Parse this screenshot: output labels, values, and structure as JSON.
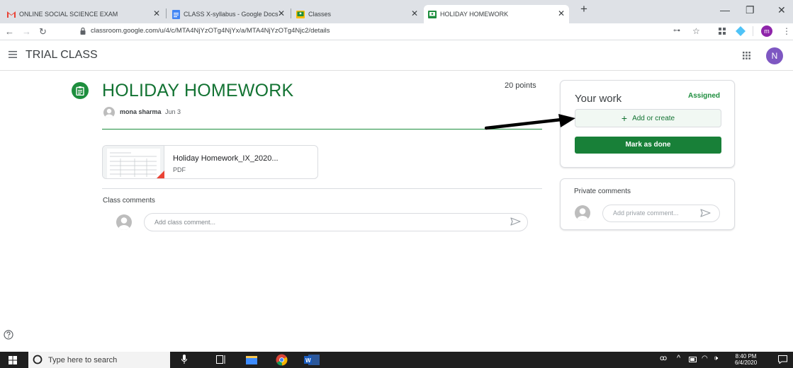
{
  "browser": {
    "tabs": [
      {
        "title": "ONLINE SOCIAL SCIENCE EXAM",
        "icon": "gmail-icon"
      },
      {
        "title": "CLASS X-syllabus - Google Docs",
        "icon": "docs-icon"
      },
      {
        "title": "Classes",
        "icon": "classroom-icon"
      },
      {
        "title": "HOLIDAY HOMEWORK",
        "icon": "classroom-icon",
        "active": true
      }
    ],
    "url": "classroom.google.com/u/4/c/MTA4NjYzOTg4NjYx/a/MTA4NjYzOTg4Njc2/details",
    "profile_initial": "m"
  },
  "app": {
    "class_name": "TRIAL CLASS",
    "account_initial": "N"
  },
  "assignment": {
    "title": "HOLIDAY HOMEWORK",
    "points": "20 points",
    "author": "mona sharma",
    "date": "Jun 3",
    "attachment": {
      "name": "Holiday Homework_IX_2020...",
      "type": "PDF"
    },
    "class_comments_label": "Class comments",
    "class_comment_placeholder": "Add class comment..."
  },
  "your_work": {
    "title": "Your work",
    "status": "Assigned",
    "add_label": "Add or create",
    "done_label": "Mark as done"
  },
  "private_comments": {
    "label": "Private comments",
    "placeholder": "Add private comment..."
  },
  "taskbar": {
    "search_placeholder": "Type here to search",
    "time": "8:40 PM",
    "date": "6/4/2020"
  },
  "colors": {
    "accent": "#1e8e3e",
    "button": "#188038"
  }
}
